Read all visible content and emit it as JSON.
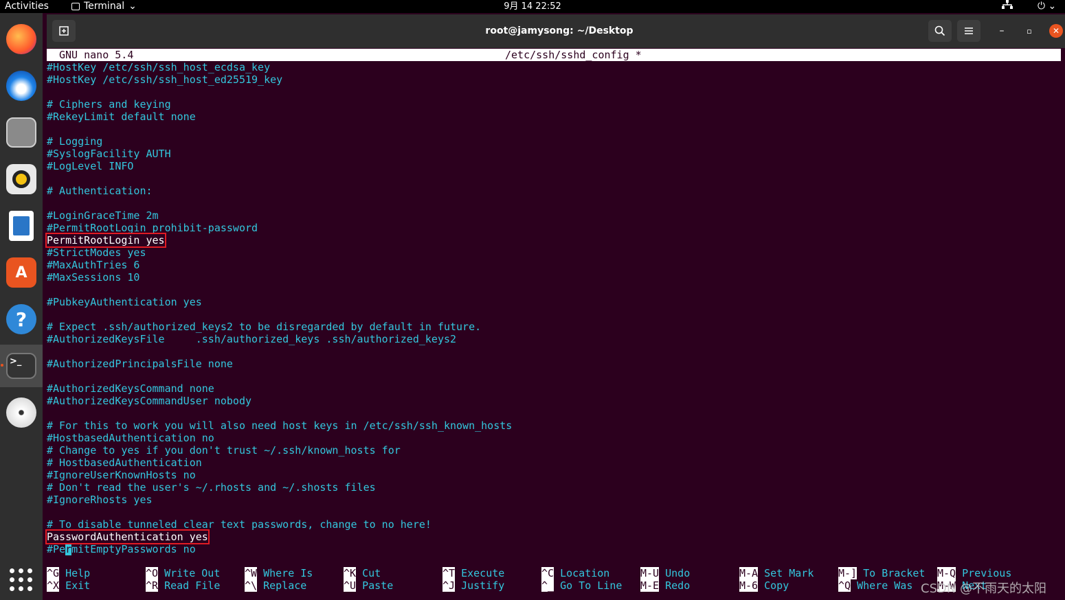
{
  "topbar": {
    "activities": "Activities",
    "app_menu": "Terminal",
    "clock": "9月 14 22:52"
  },
  "window": {
    "title": "root@jamysong: ~/Desktop"
  },
  "nano": {
    "version": "GNU nano 5.4",
    "file": "/etc/ssh/sshd_config *",
    "lines": [
      "#HostKey /etc/ssh/ssh_host_ecdsa_key",
      "#HostKey /etc/ssh/ssh_host_ed25519_key",
      "",
      "# Ciphers and keying",
      "#RekeyLimit default none",
      "",
      "# Logging",
      "#SyslogFacility AUTH",
      "#LogLevel INFO",
      "",
      "# Authentication:",
      "",
      "#LoginGraceTime 2m",
      "#PermitRootLogin prohibit-password",
      "PermitRootLogin yes",
      "#StrictModes yes",
      "#MaxAuthTries 6",
      "#MaxSessions 10",
      "",
      "#PubkeyAuthentication yes",
      "",
      "# Expect .ssh/authorized_keys2 to be disregarded by default in future.",
      "#AuthorizedKeysFile     .ssh/authorized_keys .ssh/authorized_keys2",
      "",
      "#AuthorizedPrincipalsFile none",
      "",
      "#AuthorizedKeysCommand none",
      "#AuthorizedKeysCommandUser nobody",
      "",
      "# For this to work you will also need host keys in /etc/ssh/ssh_known_hosts",
      "#HostbasedAuthentication no",
      "# Change to yes if you don't trust ~/.ssh/known_hosts for",
      "# HostbasedAuthentication",
      "#IgnoreUserKnownHosts no",
      "# Don't read the user's ~/.rhosts and ~/.shosts files",
      "#IgnoreRhosts yes",
      "",
      "# To disable tunneled clear text passwords, change to no here!",
      "PasswordAuthentication yes",
      "#PermitEmptyPasswords no"
    ],
    "highlighted_lines": [
      14,
      38
    ],
    "cursor": {
      "line": 39,
      "char": 3
    },
    "shortcuts": [
      {
        "k1": "^G",
        "l1": "Help",
        "k2": "^X",
        "l2": "Exit"
      },
      {
        "k1": "^O",
        "l1": "Write Out",
        "k2": "^R",
        "l2": "Read File"
      },
      {
        "k1": "^W",
        "l1": "Where Is",
        "k2": "^\\",
        "l2": "Replace"
      },
      {
        "k1": "^K",
        "l1": "Cut",
        "k2": "^U",
        "l2": "Paste"
      },
      {
        "k1": "^T",
        "l1": "Execute",
        "k2": "^J",
        "l2": "Justify"
      },
      {
        "k1": "^C",
        "l1": "Location",
        "k2": "^_",
        "l2": "Go To Line"
      },
      {
        "k1": "M-U",
        "l1": "Undo",
        "k2": "M-E",
        "l2": "Redo"
      },
      {
        "k1": "M-A",
        "l1": "Set Mark",
        "k2": "M-6",
        "l2": "Copy"
      },
      {
        "k1": "M-]",
        "l1": "To Bracket",
        "k2": "^Q",
        "l2": "Where Was"
      },
      {
        "k1": "M-Q",
        "l1": "Previous",
        "k2": "M-W",
        "l2": "Next"
      }
    ]
  },
  "dock": {
    "items": [
      "firefox-icon",
      "thunderbird-icon",
      "files-icon",
      "rhythmbox-icon",
      "libreoffice-writer-icon",
      "software-icon",
      "help-icon",
      "terminal-icon",
      "dvd-icon"
    ]
  },
  "watermark": "CSDN @不雨天的太阳"
}
